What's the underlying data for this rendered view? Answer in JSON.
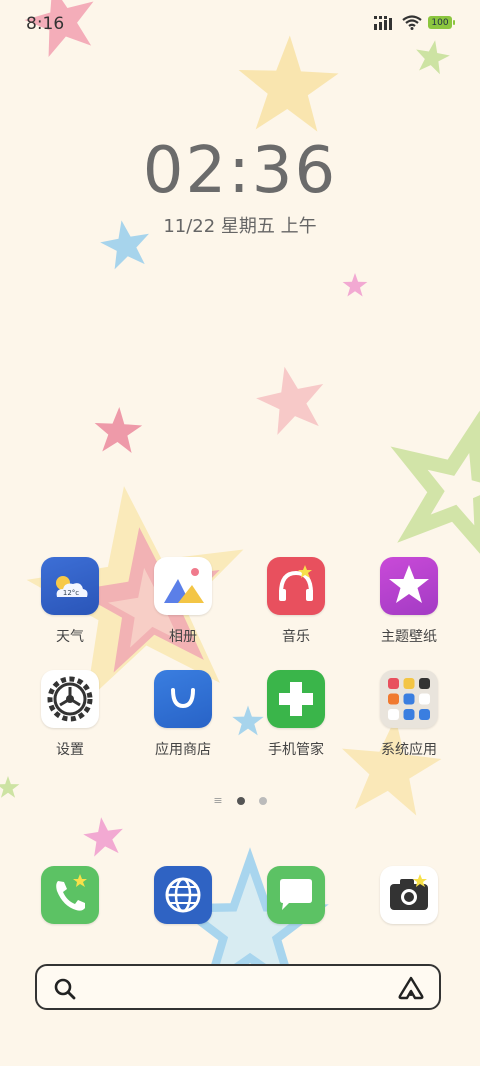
{
  "status_bar": {
    "time": "8:16",
    "battery": "100"
  },
  "lockclock": {
    "time": "02:36",
    "date": "11/22 星期五 上午"
  },
  "apps": [
    {
      "label": "天气",
      "icon": "weather-icon",
      "temp": "12°c"
    },
    {
      "label": "相册",
      "icon": "gallery-icon"
    },
    {
      "label": "音乐",
      "icon": "music-icon"
    },
    {
      "label": "主题壁纸",
      "icon": "themes-icon"
    },
    {
      "label": "设置",
      "icon": "settings-icon"
    },
    {
      "label": "应用商店",
      "icon": "app-store-icon"
    },
    {
      "label": "手机管家",
      "icon": "security-icon"
    },
    {
      "label": "系统应用",
      "icon": "system-apps-folder-icon"
    }
  ],
  "page_indicator": {
    "pages": 2,
    "current": 1
  },
  "dock": [
    {
      "icon": "phone-icon"
    },
    {
      "icon": "browser-icon"
    },
    {
      "icon": "messages-icon"
    },
    {
      "icon": "camera-icon"
    }
  ],
  "search_bar": {
    "search_icon": "search-icon",
    "assistant_icon": "assistant-icon"
  },
  "colors": {
    "background": "#fdf6ea",
    "clock_text": "#6b6b6b",
    "battery": "#8cc63f"
  }
}
